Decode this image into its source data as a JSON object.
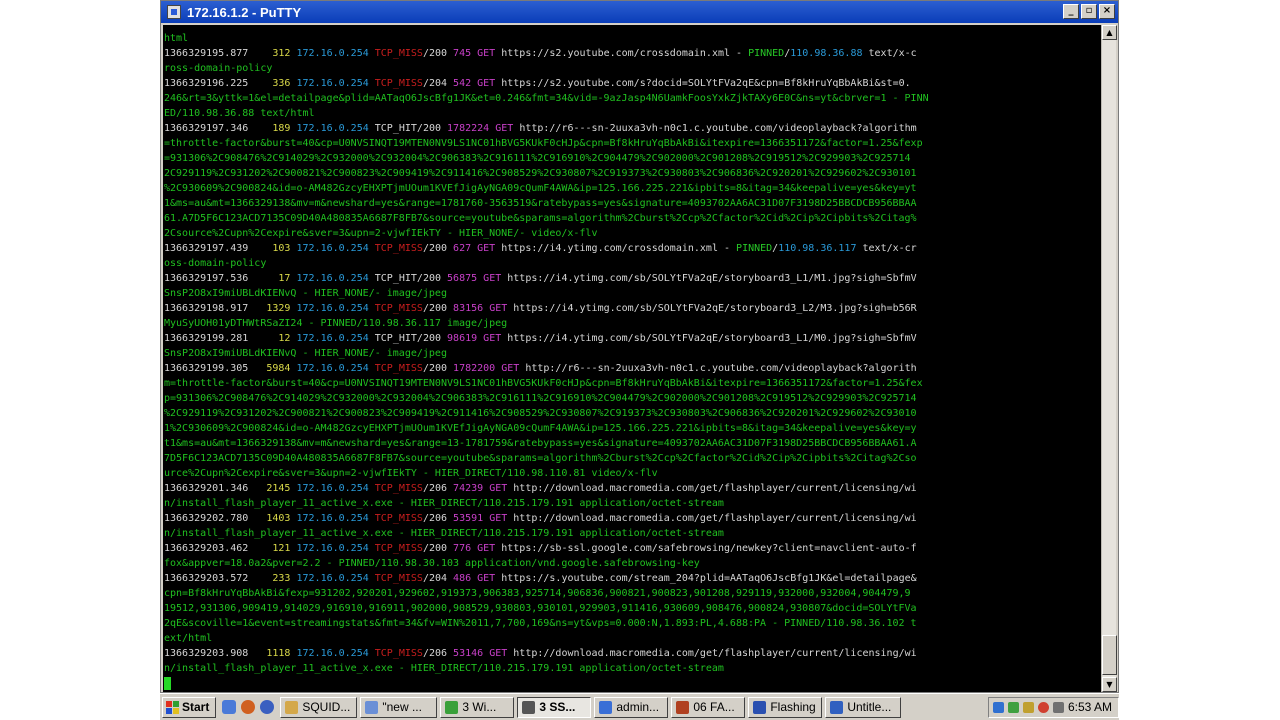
{
  "window": {
    "title": "172.16.1.2 - PuTTY"
  },
  "terminal": {
    "lines": [
      [
        {
          "c": "cont",
          "t": "html"
        }
      ],
      [
        {
          "c": "ts",
          "t": "1366329195.877"
        },
        {
          "c": "t",
          "t": "    "
        },
        {
          "c": "dur",
          "t": "312"
        },
        {
          "c": "t",
          "t": " "
        },
        {
          "c": "ip",
          "t": "172.16.0.254"
        },
        {
          "c": "t",
          "t": " "
        },
        {
          "c": "miss",
          "t": "TCP_MISS"
        },
        {
          "c": "code",
          "t": "/200 "
        },
        {
          "c": "size",
          "t": "745"
        },
        {
          "c": "t",
          "t": " "
        },
        {
          "c": "meth",
          "t": "GET"
        },
        {
          "c": "t",
          "t": " "
        },
        {
          "c": "url",
          "t": "https://s2.youtube.com/crossdomain.xml"
        },
        {
          "c": "t",
          "t": " - "
        },
        {
          "c": "hier",
          "t": "PINNED"
        },
        {
          "c": "t",
          "t": "/"
        },
        {
          "c": "peer",
          "t": "110.98.36.88"
        },
        {
          "c": "t",
          "t": " "
        },
        {
          "c": "ctype",
          "t": "text/x-c"
        }
      ],
      [
        {
          "c": "cont",
          "t": "ross-domain-policy"
        }
      ],
      [
        {
          "c": "ts",
          "t": "1366329196.225"
        },
        {
          "c": "t",
          "t": "    "
        },
        {
          "c": "dur",
          "t": "336"
        },
        {
          "c": "t",
          "t": " "
        },
        {
          "c": "ip",
          "t": "172.16.0.254"
        },
        {
          "c": "t",
          "t": " "
        },
        {
          "c": "miss",
          "t": "TCP_MISS"
        },
        {
          "c": "code",
          "t": "/204 "
        },
        {
          "c": "size",
          "t": "542"
        },
        {
          "c": "t",
          "t": " "
        },
        {
          "c": "meth",
          "t": "GET"
        },
        {
          "c": "t",
          "t": " "
        },
        {
          "c": "url",
          "t": "https://s2.youtube.com/s?docid=SOLYtFVa2qE&cpn=Bf8kHruYqBbAkBi&st=0."
        }
      ],
      [
        {
          "c": "cont",
          "t": "246&rt=3&yttk=1&el=detailpage&plid=AATaqO6JscBfg1JK&et=0.246&fmt=34&vid=-9azJasp4N6UamkFoosYxkZjkTAXy6E0C&ns=yt&cbrver=1 - PINN"
        }
      ],
      [
        {
          "c": "cont",
          "t": "ED/110.98.36.88 text/html"
        }
      ],
      [
        {
          "c": "ts",
          "t": "1366329197.346"
        },
        {
          "c": "t",
          "t": "    "
        },
        {
          "c": "dur",
          "t": "189"
        },
        {
          "c": "t",
          "t": " "
        },
        {
          "c": "ip",
          "t": "172.16.0.254"
        },
        {
          "c": "t",
          "t": " "
        },
        {
          "c": "hit",
          "t": "TCP_HIT"
        },
        {
          "c": "code",
          "t": "/200 "
        },
        {
          "c": "size",
          "t": "1782224"
        },
        {
          "c": "t",
          "t": " "
        },
        {
          "c": "meth",
          "t": "GET"
        },
        {
          "c": "t",
          "t": " "
        },
        {
          "c": "url",
          "t": "http://r6---sn-2uuxa3vh-n0c1.c.youtube.com/videoplayback?algorithm"
        }
      ],
      [
        {
          "c": "cont",
          "t": "=throttle-factor&burst=40&cp=U0NVSINQT19MTEN0NV9LS1NC01hBVG5KUkF0cHJp&cpn=Bf8kHruYqBbAkBi&itexpire=1366351172&factor=1.25&fexp"
        }
      ],
      [
        {
          "c": "cont",
          "t": "=931306%2C908476%2C914029%2C932000%2C932004%2C906383%2C916111%2C916910%2C904479%2C902000%2C901208%2C919512%2C929903%2C925714"
        }
      ],
      [
        {
          "c": "cont",
          "t": "2C929119%2C931202%2C900821%2C900823%2C909419%2C911416%2C908529%2C930807%2C919373%2C930803%2C906836%2C920201%2C929602%2C930101"
        }
      ],
      [
        {
          "c": "cont",
          "t": "%2C930609%2C900824&id=o-AM482GzcyEHXPTjmUOum1KVEfJigAyNGA09cQumF4AWA&ip=125.166.225.221&ipbits=8&itag=34&keepalive=yes&key=yt"
        }
      ],
      [
        {
          "c": "cont",
          "t": "1&ms=au&mt=1366329138&mv=m&newshard=yes&range=1781760-3563519&ratebypass=yes&signature=4093702AA6AC31D07F3198D25BBCDCB956BBAA"
        }
      ],
      [
        {
          "c": "cont",
          "t": "61.A7D5F6C123ACD7135C09D40A480835A6687F8FB7&source=youtube&sparams=algorithm%2Cburst%2Ccp%2Cfactor%2Cid%2Cip%2Cipbits%2Citag%"
        }
      ],
      [
        {
          "c": "cont",
          "t": "2Csource%2Cupn%2Cexpire&sver=3&upn=2-vjwfIEkTY - HIER_NONE/- video/x-flv"
        }
      ],
      [
        {
          "c": "ts",
          "t": "1366329197.439"
        },
        {
          "c": "t",
          "t": "    "
        },
        {
          "c": "dur",
          "t": "103"
        },
        {
          "c": "t",
          "t": " "
        },
        {
          "c": "ip",
          "t": "172.16.0.254"
        },
        {
          "c": "t",
          "t": " "
        },
        {
          "c": "miss",
          "t": "TCP_MISS"
        },
        {
          "c": "code",
          "t": "/200 "
        },
        {
          "c": "size",
          "t": "627"
        },
        {
          "c": "t",
          "t": " "
        },
        {
          "c": "meth",
          "t": "GET"
        },
        {
          "c": "t",
          "t": " "
        },
        {
          "c": "url",
          "t": "https://i4.ytimg.com/crossdomain.xml"
        },
        {
          "c": "t",
          "t": " - "
        },
        {
          "c": "hier",
          "t": "PINNED"
        },
        {
          "c": "t",
          "t": "/"
        },
        {
          "c": "peer",
          "t": "110.98.36.117"
        },
        {
          "c": "t",
          "t": " "
        },
        {
          "c": "ctype",
          "t": "text/x-cr"
        }
      ],
      [
        {
          "c": "cont",
          "t": "oss-domain-policy"
        }
      ],
      [
        {
          "c": "ts",
          "t": "1366329197.536"
        },
        {
          "c": "t",
          "t": "     "
        },
        {
          "c": "dur",
          "t": "17"
        },
        {
          "c": "t",
          "t": " "
        },
        {
          "c": "ip",
          "t": "172.16.0.254"
        },
        {
          "c": "t",
          "t": " "
        },
        {
          "c": "hit",
          "t": "TCP_HIT"
        },
        {
          "c": "code",
          "t": "/200 "
        },
        {
          "c": "size",
          "t": "56875"
        },
        {
          "c": "t",
          "t": " "
        },
        {
          "c": "meth",
          "t": "GET"
        },
        {
          "c": "t",
          "t": " "
        },
        {
          "c": "url",
          "t": "https://i4.ytimg.com/sb/SOLYtFVa2qE/storyboard3_L1/M1.jpg?sigh=SbfmV"
        }
      ],
      [
        {
          "c": "cont",
          "t": "SnsP2O8xI9miUBLdKIENvQ - HIER_NONE/- image/jpeg"
        }
      ],
      [
        {
          "c": "ts",
          "t": "1366329198.917"
        },
        {
          "c": "t",
          "t": "   "
        },
        {
          "c": "dur",
          "t": "1329"
        },
        {
          "c": "t",
          "t": " "
        },
        {
          "c": "ip",
          "t": "172.16.0.254"
        },
        {
          "c": "t",
          "t": " "
        },
        {
          "c": "miss",
          "t": "TCP_MISS"
        },
        {
          "c": "code",
          "t": "/200 "
        },
        {
          "c": "size",
          "t": "83156"
        },
        {
          "c": "t",
          "t": " "
        },
        {
          "c": "meth",
          "t": "GET"
        },
        {
          "c": "t",
          "t": " "
        },
        {
          "c": "url",
          "t": "https://i4.ytimg.com/sb/SOLYtFVa2qE/storyboard3_L2/M3.jpg?sigh=b56R"
        }
      ],
      [
        {
          "c": "cont",
          "t": "MyuSyUOH01yDTHWtRSaZI24 - PINNED/110.98.36.117 image/jpeg"
        }
      ],
      [
        {
          "c": "ts",
          "t": "1366329199.281"
        },
        {
          "c": "t",
          "t": "     "
        },
        {
          "c": "dur",
          "t": "12"
        },
        {
          "c": "t",
          "t": " "
        },
        {
          "c": "ip",
          "t": "172.16.0.254"
        },
        {
          "c": "t",
          "t": " "
        },
        {
          "c": "hit",
          "t": "TCP_HIT"
        },
        {
          "c": "code",
          "t": "/200 "
        },
        {
          "c": "size",
          "t": "98619"
        },
        {
          "c": "t",
          "t": " "
        },
        {
          "c": "meth",
          "t": "GET"
        },
        {
          "c": "t",
          "t": " "
        },
        {
          "c": "url",
          "t": "https://i4.ytimg.com/sb/SOLYtFVa2qE/storyboard3_L1/M0.jpg?sigh=SbfmV"
        }
      ],
      [
        {
          "c": "cont",
          "t": "SnsP2O8xI9miUBLdKIENvQ - HIER_NONE/- image/jpeg"
        }
      ],
      [
        {
          "c": "ts",
          "t": "1366329199.305"
        },
        {
          "c": "t",
          "t": "   "
        },
        {
          "c": "dur",
          "t": "5984"
        },
        {
          "c": "t",
          "t": " "
        },
        {
          "c": "ip",
          "t": "172.16.0.254"
        },
        {
          "c": "t",
          "t": " "
        },
        {
          "c": "miss",
          "t": "TCP_MISS"
        },
        {
          "c": "code",
          "t": "/200 "
        },
        {
          "c": "size",
          "t": "1782200"
        },
        {
          "c": "t",
          "t": " "
        },
        {
          "c": "meth",
          "t": "GET"
        },
        {
          "c": "t",
          "t": " "
        },
        {
          "c": "url",
          "t": "http://r6---sn-2uuxa3vh-n0c1.c.youtube.com/videoplayback?algorith"
        }
      ],
      [
        {
          "c": "cont",
          "t": "m=throttle-factor&burst=40&cp=U0NVSINQT19MTEN0NV9LS1NC01hBVG5KUkF0cHJp&cpn=Bf8kHruYqBbAkBi&itexpire=1366351172&factor=1.25&fex"
        }
      ],
      [
        {
          "c": "cont",
          "t": "p=931306%2C908476%2C914029%2C932000%2C932004%2C906383%2C916111%2C916910%2C904479%2C902000%2C901208%2C919512%2C929903%2C925714"
        }
      ],
      [
        {
          "c": "cont",
          "t": "%2C929119%2C931202%2C900821%2C900823%2C909419%2C911416%2C908529%2C930807%2C919373%2C930803%2C906836%2C920201%2C929602%2C93010"
        }
      ],
      [
        {
          "c": "cont",
          "t": "1%2C930609%2C900824&id=o-AM482GzcyEHXPTjmUOum1KVEfJigAyNGA09cQumF4AWA&ip=125.166.225.221&ipbits=8&itag=34&keepalive=yes&key=y"
        }
      ],
      [
        {
          "c": "cont",
          "t": "t1&ms=au&mt=1366329138&mv=m&newshard=yes&range=13-1781759&ratebypass=yes&signature=4093702AA6AC31D07F3198D25BBCDCB956BBAA61.A"
        }
      ],
      [
        {
          "c": "cont",
          "t": "7D5F6C123ACD7135C09D40A480835A6687F8FB7&source=youtube&sparams=algorithm%2Cburst%2Ccp%2Cfactor%2Cid%2Cip%2Cipbits%2Citag%2Cso"
        }
      ],
      [
        {
          "c": "cont",
          "t": "urce%2Cupn%2Cexpire&sver=3&upn=2-vjwfIEkTY - HIER_DIRECT/110.98.110.81 video/x-flv"
        }
      ],
      [
        {
          "c": "ts",
          "t": "1366329201.346"
        },
        {
          "c": "t",
          "t": "   "
        },
        {
          "c": "dur",
          "t": "2145"
        },
        {
          "c": "t",
          "t": " "
        },
        {
          "c": "ip",
          "t": "172.16.0.254"
        },
        {
          "c": "t",
          "t": " "
        },
        {
          "c": "miss",
          "t": "TCP_MISS"
        },
        {
          "c": "code",
          "t": "/206 "
        },
        {
          "c": "size",
          "t": "74239"
        },
        {
          "c": "t",
          "t": " "
        },
        {
          "c": "meth",
          "t": "GET"
        },
        {
          "c": "t",
          "t": " "
        },
        {
          "c": "url",
          "t": "http://download.macromedia.com/get/flashplayer/current/licensing/wi"
        }
      ],
      [
        {
          "c": "cont",
          "t": "n/install_flash_player_11_active_x.exe - HIER_DIRECT/110.215.179.191 application/octet-stream"
        }
      ],
      [
        {
          "c": "ts",
          "t": "1366329202.780"
        },
        {
          "c": "t",
          "t": "   "
        },
        {
          "c": "dur",
          "t": "1403"
        },
        {
          "c": "t",
          "t": " "
        },
        {
          "c": "ip",
          "t": "172.16.0.254"
        },
        {
          "c": "t",
          "t": " "
        },
        {
          "c": "miss",
          "t": "TCP_MISS"
        },
        {
          "c": "code",
          "t": "/206 "
        },
        {
          "c": "size",
          "t": "53591"
        },
        {
          "c": "t",
          "t": " "
        },
        {
          "c": "meth",
          "t": "GET"
        },
        {
          "c": "t",
          "t": " "
        },
        {
          "c": "url",
          "t": "http://download.macromedia.com/get/flashplayer/current/licensing/wi"
        }
      ],
      [
        {
          "c": "cont",
          "t": "n/install_flash_player_11_active_x.exe - HIER_DIRECT/110.215.179.191 application/octet-stream"
        }
      ],
      [
        {
          "c": "ts",
          "t": "1366329203.462"
        },
        {
          "c": "t",
          "t": "    "
        },
        {
          "c": "dur",
          "t": "121"
        },
        {
          "c": "t",
          "t": " "
        },
        {
          "c": "ip",
          "t": "172.16.0.254"
        },
        {
          "c": "t",
          "t": " "
        },
        {
          "c": "miss",
          "t": "TCP_MISS"
        },
        {
          "c": "code",
          "t": "/200 "
        },
        {
          "c": "size",
          "t": "776"
        },
        {
          "c": "t",
          "t": " "
        },
        {
          "c": "meth",
          "t": "GET"
        },
        {
          "c": "t",
          "t": " "
        },
        {
          "c": "url",
          "t": "https://sb-ssl.google.com/safebrowsing/newkey?client=navclient-auto-f"
        }
      ],
      [
        {
          "c": "cont",
          "t": "fox&appver=18.0a2&pver=2.2 - PINNED/110.98.30.103 application/vnd.google.safebrowsing-key"
        }
      ],
      [
        {
          "c": "ts",
          "t": "1366329203.572"
        },
        {
          "c": "t",
          "t": "    "
        },
        {
          "c": "dur",
          "t": "233"
        },
        {
          "c": "t",
          "t": " "
        },
        {
          "c": "ip",
          "t": "172.16.0.254"
        },
        {
          "c": "t",
          "t": " "
        },
        {
          "c": "miss",
          "t": "TCP_MISS"
        },
        {
          "c": "code",
          "t": "/204 "
        },
        {
          "c": "size",
          "t": "486"
        },
        {
          "c": "t",
          "t": " "
        },
        {
          "c": "meth",
          "t": "GET"
        },
        {
          "c": "t",
          "t": " "
        },
        {
          "c": "url",
          "t": "https://s.youtube.com/stream_204?plid=AATaqO6JscBfg1JK&el=detailpage&"
        }
      ],
      [
        {
          "c": "cont",
          "t": "cpn=Bf8kHruYqBbAkBi&fexp=931202,920201,929602,919373,906383,925714,906836,900821,900823,901208,929119,932000,932004,904479,9"
        }
      ],
      [
        {
          "c": "cont",
          "t": "19512,931306,909419,914029,916910,916911,902000,908529,930803,930101,929903,911416,930609,908476,900824,930807&docid=SOLYtFVa"
        }
      ],
      [
        {
          "c": "cont",
          "t": "2qE&scoville=1&event=streamingstats&fmt=34&fv=WIN%2011,7,700,169&ns=yt&vps=0.000:N,1.893:PL,4.688:PA - PINNED/110.98.36.102 t"
        }
      ],
      [
        {
          "c": "cont",
          "t": "ext/html"
        }
      ],
      [
        {
          "c": "ts",
          "t": "1366329203.908"
        },
        {
          "c": "t",
          "t": "   "
        },
        {
          "c": "dur",
          "t": "1118"
        },
        {
          "c": "t",
          "t": " "
        },
        {
          "c": "ip",
          "t": "172.16.0.254"
        },
        {
          "c": "t",
          "t": " "
        },
        {
          "c": "miss",
          "t": "TCP_MISS"
        },
        {
          "c": "code",
          "t": "/206 "
        },
        {
          "c": "size",
          "t": "53146"
        },
        {
          "c": "t",
          "t": " "
        },
        {
          "c": "meth",
          "t": "GET"
        },
        {
          "c": "t",
          "t": " "
        },
        {
          "c": "url",
          "t": "http://download.macromedia.com/get/flashplayer/current/licensing/wi"
        }
      ],
      [
        {
          "c": "cont",
          "t": "n/install_flash_player_11_active_x.exe - HIER_DIRECT/110.215.179.191 application/octet-stream"
        }
      ]
    ]
  },
  "taskbar": {
    "start_label": "Start",
    "tasks": [
      {
        "label": "SQUID...",
        "color": "#d4a84a",
        "active": false,
        "width": 77
      },
      {
        "label": "\"new ...",
        "color": "#6a8fd6",
        "active": false,
        "width": 77
      },
      {
        "label": "3 Wi...",
        "color": "#3aa03a",
        "active": false,
        "width": 74
      },
      {
        "label": "3 SS...",
        "color": "#555555",
        "active": true,
        "width": 74
      },
      {
        "label": "admin...",
        "color": "#3a6fd6",
        "active": false,
        "width": 74
      },
      {
        "label": "06 FA...",
        "color": "#b04020",
        "active": false,
        "width": 74
      },
      {
        "label": "Flashing",
        "color": "#2a50b0",
        "active": false,
        "width": 74
      },
      {
        "label": "Untitle...",
        "color": "#3060c0",
        "active": false,
        "width": 76
      }
    ],
    "clock": "6:53 AM"
  },
  "colors": {
    "titlebar": "#0a3db8",
    "terminal_bg": "#000000"
  }
}
